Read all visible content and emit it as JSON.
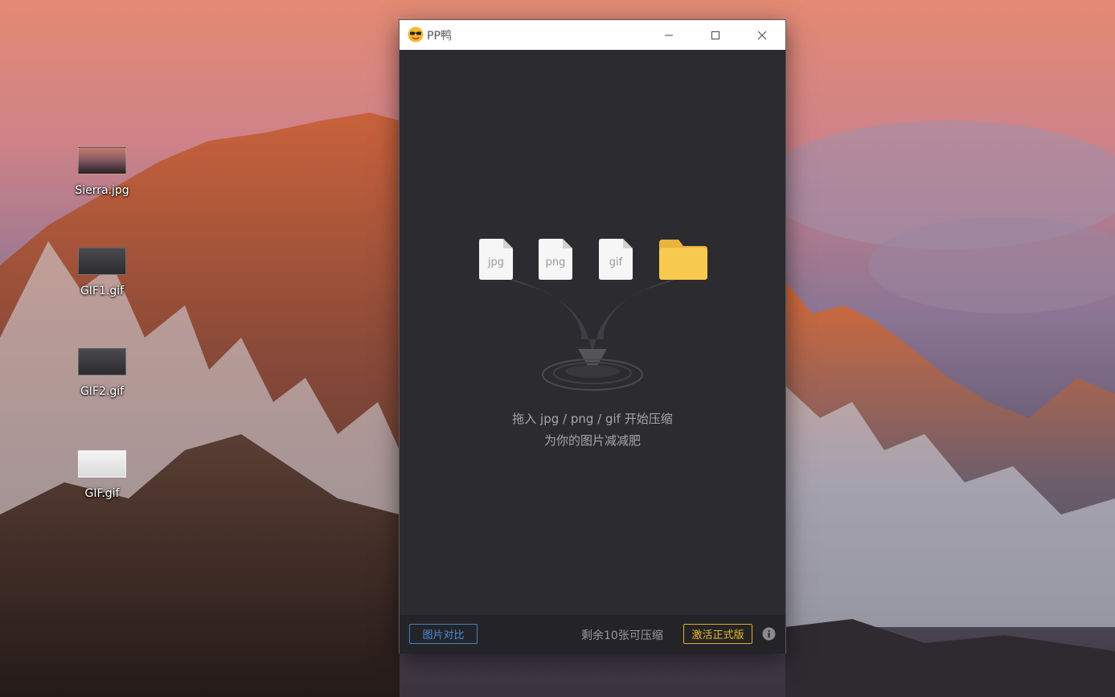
{
  "desktop": {
    "icons": [
      {
        "label": "Sierra.jpg",
        "icon": "image-file-icon"
      },
      {
        "label": "GIF1.gif",
        "icon": "gif-file-icon"
      },
      {
        "label": "GIF2.gif",
        "icon": "gif-file-icon"
      },
      {
        "label": "GIF.gif",
        "icon": "gif-file-icon"
      }
    ]
  },
  "window": {
    "title": "PP鸭",
    "app_icon": "duck-sunglasses-icon",
    "controls": [
      "minimize-icon",
      "maximize-icon",
      "close-icon"
    ]
  },
  "dropzone": {
    "file_types": [
      "jpg",
      "png",
      "gif"
    ],
    "folder_icon": "folder-icon",
    "hint_line1": "拖入 jpg / png / gif 开始压缩",
    "hint_line2": "为你的图片减减肥"
  },
  "footer": {
    "compare_label": "图片对比",
    "remaining_text": "剩余10张可压缩",
    "activate_label": "激活正式版",
    "info_icon": "info-icon"
  },
  "colors": {
    "window_bg": "#2c2c30",
    "footer_bg": "#242428",
    "accent_blue": "#4a90d9",
    "accent_gold": "#e8b624",
    "folder": "#f7c94e"
  }
}
